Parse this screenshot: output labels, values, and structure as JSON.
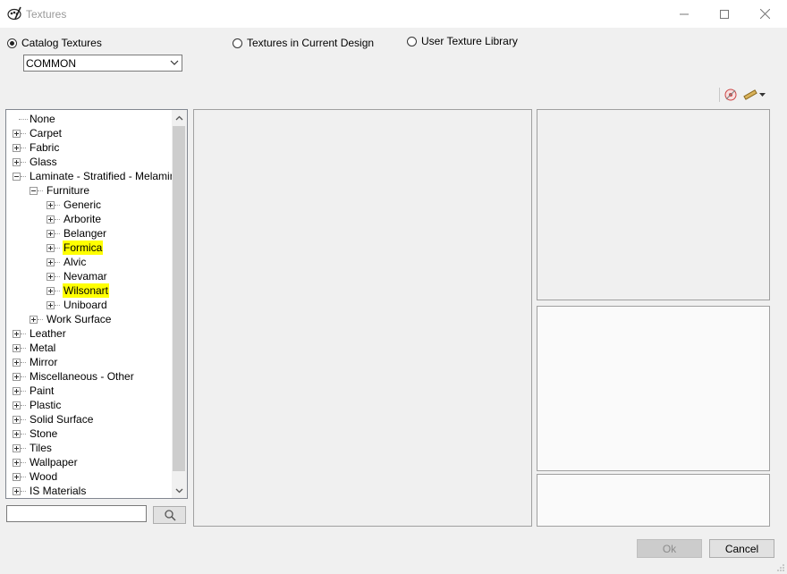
{
  "window": {
    "title": "Textures"
  },
  "source": {
    "catalog_label": "Catalog Textures",
    "current_design_label": "Textures in Current Design",
    "user_library_label": "User Texture Library",
    "selected": "catalog"
  },
  "catalog_combo": {
    "value": "COMMON"
  },
  "tree": {
    "nodes": [
      {
        "label": "None",
        "level": 0,
        "expander": "none",
        "highlight": false
      },
      {
        "label": "Carpet",
        "level": 0,
        "expander": "plus",
        "highlight": false
      },
      {
        "label": "Fabric",
        "level": 0,
        "expander": "plus",
        "highlight": false
      },
      {
        "label": "Glass",
        "level": 0,
        "expander": "plus",
        "highlight": false
      },
      {
        "label": "Laminate - Stratified - Melamine",
        "level": 0,
        "expander": "minus",
        "highlight": false
      },
      {
        "label": "Furniture",
        "level": 1,
        "expander": "minus",
        "highlight": false
      },
      {
        "label": "Generic",
        "level": 2,
        "expander": "plus",
        "highlight": false
      },
      {
        "label": "Arborite",
        "level": 2,
        "expander": "plus",
        "highlight": false
      },
      {
        "label": "Belanger",
        "level": 2,
        "expander": "plus",
        "highlight": false
      },
      {
        "label": "Formica",
        "level": 2,
        "expander": "plus",
        "highlight": true
      },
      {
        "label": "Alvic",
        "level": 2,
        "expander": "plus",
        "highlight": false
      },
      {
        "label": "Nevamar",
        "level": 2,
        "expander": "plus",
        "highlight": false
      },
      {
        "label": "Wilsonart",
        "level": 2,
        "expander": "plus",
        "highlight": true
      },
      {
        "label": "Uniboard",
        "level": 2,
        "expander": "plus",
        "highlight": false
      },
      {
        "label": "Work Surface",
        "level": 1,
        "expander": "plus",
        "highlight": false
      },
      {
        "label": "Leather",
        "level": 0,
        "expander": "plus",
        "highlight": false
      },
      {
        "label": "Metal",
        "level": 0,
        "expander": "plus",
        "highlight": false
      },
      {
        "label": "Mirror",
        "level": 0,
        "expander": "plus",
        "highlight": false
      },
      {
        "label": "Miscellaneous - Other",
        "level": 0,
        "expander": "plus",
        "highlight": false
      },
      {
        "label": "Paint",
        "level": 0,
        "expander": "plus",
        "highlight": false
      },
      {
        "label": "Plastic",
        "level": 0,
        "expander": "plus",
        "highlight": false
      },
      {
        "label": "Solid Surface",
        "level": 0,
        "expander": "plus",
        "highlight": false
      },
      {
        "label": "Stone",
        "level": 0,
        "expander": "plus",
        "highlight": false
      },
      {
        "label": "Tiles",
        "level": 0,
        "expander": "plus",
        "highlight": false
      },
      {
        "label": "Wallpaper",
        "level": 0,
        "expander": "plus",
        "highlight": false
      },
      {
        "label": "Wood",
        "level": 0,
        "expander": "plus",
        "highlight": false
      },
      {
        "label": "IS Materials",
        "level": 0,
        "expander": "plus",
        "highlight": false
      }
    ]
  },
  "search": {
    "value": "",
    "placeholder": ""
  },
  "toolbar": {
    "icons": [
      "texture-settings-icon",
      "measure-tape-icon"
    ]
  },
  "buttons": {
    "ok": "Ok",
    "cancel": "Cancel"
  },
  "colors": {
    "highlight": "#ffff00",
    "disabled_text": "#8c8c8c"
  }
}
